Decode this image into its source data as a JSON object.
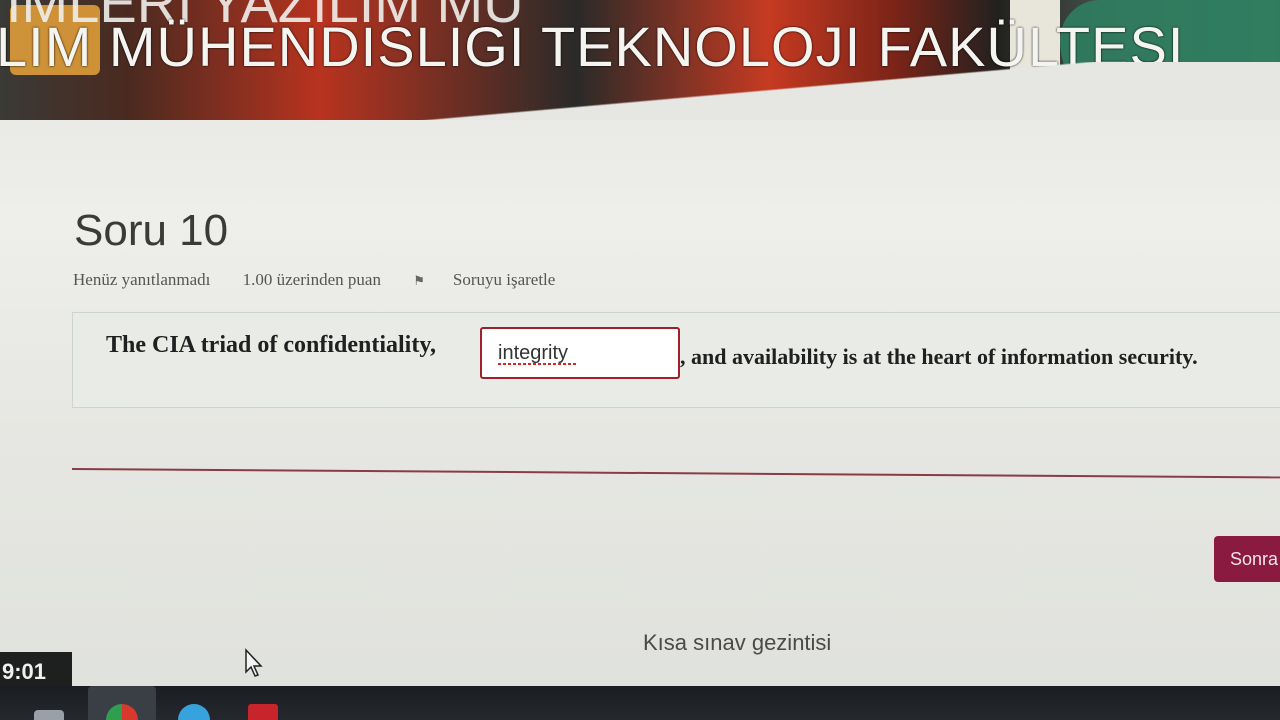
{
  "banner": {
    "title": "LIM MÜHENDISLIGI TEKNOLOJI FAKÜLTESI",
    "title_top": "IMLERI YAZILIM MU"
  },
  "question": {
    "title": "Soru 10",
    "status": "Henüz yanıtlanmadı",
    "points": "1.00 üzerinden puan",
    "flag_label": "Soruyu işaretle",
    "text_before": "The CIA triad of confidentiality,",
    "answer_value": "integrity",
    "text_after": ", and availability is at the heart of information security."
  },
  "navigation": {
    "next_label": "Sonra",
    "quiz_nav_label": "Kısa sınav gezintisi"
  },
  "timer": {
    "value": "9:01"
  },
  "colors": {
    "accent": "#8b1a40",
    "input_border": "#a0202a",
    "divider": "#8a3c45"
  },
  "icons": {
    "flag": "flag-icon",
    "cursor": "mouse-cursor-icon"
  }
}
